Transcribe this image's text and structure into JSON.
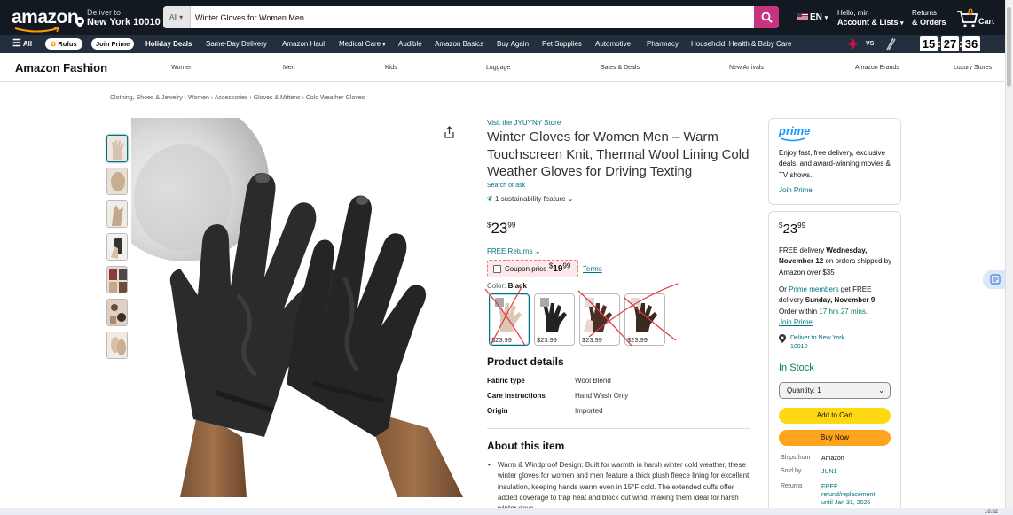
{
  "header": {
    "logo": "amazon",
    "deliver_line1": "Deliver to",
    "deliver_line2": "New York 10010",
    "search_category": "All",
    "search_value": "Winter Gloves for Women Men",
    "language": "EN",
    "account_line1": "Hello, min",
    "account_line2": "Account & Lists",
    "returns_line1": "Returns",
    "returns_line2": "& Orders",
    "cart_count": "0",
    "cart_label": "Cart"
  },
  "subnav": {
    "all": "All",
    "rufus": "Rufus",
    "join_prime": "Join Prime",
    "items": [
      "Holiday Deals",
      "Same-Day Delivery",
      "Amazon Haul",
      "Medical Care",
      "Audible",
      "Amazon Basics",
      "Buy Again",
      "Pet Supplies",
      "Automotive",
      "Pharmacy",
      "Household, Health & Baby Care"
    ],
    "vs": "VS",
    "clock": [
      "15",
      "27",
      "36"
    ]
  },
  "fashion": {
    "title": "Amazon Fashion",
    "nav": [
      "Women",
      "Men",
      "Kids",
      "Luggage",
      "Sales & Deals",
      "New Arrivals",
      "Amazon Brands",
      "Luxury Stores"
    ]
  },
  "breadcrumb": "Clothing, Shoes & Jewelry › Women › Accessories › Gloves & Mittens › Cold Weather Gloves",
  "product": {
    "store_link": "Visit the JYUYNY Store",
    "title": "Winter Gloves for Women Men – Warm Touchscreen Knit, Thermal Wool Lining Cold Weather Gloves for Driving Texting",
    "search_ask": "Search or ask",
    "sustainability": "1 sustainability feature",
    "price_symbol": "$",
    "price_whole": "23",
    "price_fraction": "99",
    "free_returns": "FREE Returns",
    "coupon_label": "Coupon price",
    "coupon_symbol": "$",
    "coupon_whole": "19",
    "coupon_fraction": "99",
    "terms": "Terms",
    "color_label": "Color:",
    "color_value": "Black",
    "swatches": [
      {
        "price": "$23.99"
      },
      {
        "price": "$23.99"
      },
      {
        "price": "$23.99"
      },
      {
        "price": "$23.99"
      }
    ],
    "details_title": "Product details",
    "details": [
      {
        "k": "Fabric type",
        "v": "Wool Blend"
      },
      {
        "k": "Care instructions",
        "v": "Hand Wash Only"
      },
      {
        "k": "Origin",
        "v": "Imported"
      }
    ],
    "about_title": "About this item",
    "about_text": "Warm & Windproof Design: Built for warmth in harsh winter cold weather, these winter gloves for women and men feature a thick plush fleece lining for excellent insulation, keeping hands warm even in 15°F cold. The extended cuffs offer added coverage to trap heat and block out wind, making them ideal for harsh winter days."
  },
  "prime_box": {
    "logo": "prime",
    "text": "Enjoy fast, free delivery, exclusive deals, and award-winning movies & TV shows.",
    "join": "Join Prime"
  },
  "buy_box": {
    "price_symbol": "$",
    "price_whole": "23",
    "price_fraction": "99",
    "del1_a": "FREE delivery ",
    "del1_b": "Wednesday, November 12",
    "del1_c": " on orders shipped by Amazon over $35",
    "del2_a": "Or ",
    "del2_b": "Prime members",
    "del2_c": " get FREE delivery ",
    "del2_d": "Sunday, November 9",
    "del2_e": ". Order within ",
    "del2_f": "17 hrs 27 mins",
    "del2_g": ".",
    "del2_join": "Join Prime",
    "location_1": "Deliver to New York",
    "location_2": "10010",
    "stock": "In Stock",
    "quantity": "Quantity: 1",
    "add_to_cart": "Add to Cart",
    "buy_now": "Buy Now",
    "ships_from_k": "Ships from",
    "ships_from_v": "Amazon",
    "sold_by_k": "Sold by",
    "sold_by_v": "JUN1",
    "returns_k": "Returns",
    "returns_v1": "FREE",
    "returns_v2": "refund/replacement",
    "returns_v3": "until Jan 31, 2026"
  },
  "taskbar_time": "16:32",
  "colors": {
    "nav_dark": "#131921",
    "nav_sub": "#232f3e",
    "search_btn": "#c7337f",
    "link": "#007185",
    "add_to_cart": "#ffd814",
    "buy_now": "#ffa41c",
    "stock_green": "#067d62"
  }
}
